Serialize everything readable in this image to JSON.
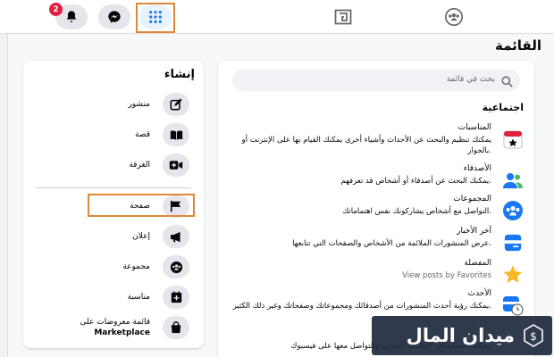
{
  "topbar": {
    "notifications_badge": "2",
    "icons": [
      "bell-icon",
      "messenger-icon",
      "grid-menu-icon",
      "gaming-icon",
      "groups-icon"
    ]
  },
  "menu": {
    "title": "القائمة"
  },
  "create": {
    "title": "إنشاء",
    "items": [
      {
        "label": "منشور",
        "icon": "edit-post-icon"
      },
      {
        "label": "قصة",
        "icon": "book-icon"
      },
      {
        "label": "الغرفة",
        "icon": "video-plus-icon"
      },
      {
        "label": "صفحة",
        "icon": "flag-icon"
      },
      {
        "label": "إعلان",
        "icon": "megaphone-icon"
      },
      {
        "label": "مجموعة",
        "icon": "group-icon"
      },
      {
        "label": "مناسبة",
        "icon": "event-plus-icon"
      },
      {
        "label_line1": "قائمة معروضات على",
        "label_line2": "Marketplace",
        "icon": "shopping-bag-icon"
      }
    ]
  },
  "list": {
    "search_placeholder": "بحث في قائمة",
    "section_title": "اجتماعية",
    "items": [
      {
        "name": "المناسبات",
        "desc": "يمكنك تنظيم والبحث عن الأحداث وأشياء أخرى يمكنك القيام بها على الإنترنت أو بالجوار.",
        "icon": "calendar-icon"
      },
      {
        "name": "الأصدقاء",
        "desc": "يمكنك البحث عن أصدقاء أو أشخاص قد تعرفهم.",
        "icon": "friends-icon"
      },
      {
        "name": "المجموعات",
        "desc": "التواصل مع أشخاص يشاركونك نفس اهتماماتك.",
        "icon": "groups-icon"
      },
      {
        "name": "آخر الأخبار",
        "desc": "عرض المنشورات الملائمة من الأشخاص والصفحات التي تتابعها.",
        "icon": "news-feed-icon"
      },
      {
        "name": "المفضلة",
        "desc": "View posts by Favorites",
        "icon": "star-icon"
      },
      {
        "name": "الأحدث",
        "desc": "يمكنك رؤية أحدث المنشورات من أصدقائك ومجموعاتك وصفحاتك وغير ذلك الكثير.",
        "icon": "recent-clock-icon"
      },
      {
        "name": "",
        "desc": "يمكنك استكشاف الأنشطة التجارية والتواصل معها على فيسبوك.",
        "icon": ""
      }
    ]
  },
  "watermark": {
    "text": "ميدان المال"
  },
  "colors": {
    "accent": "#1877f2",
    "highlight": "#e0883a",
    "badge": "#e41e3f"
  }
}
